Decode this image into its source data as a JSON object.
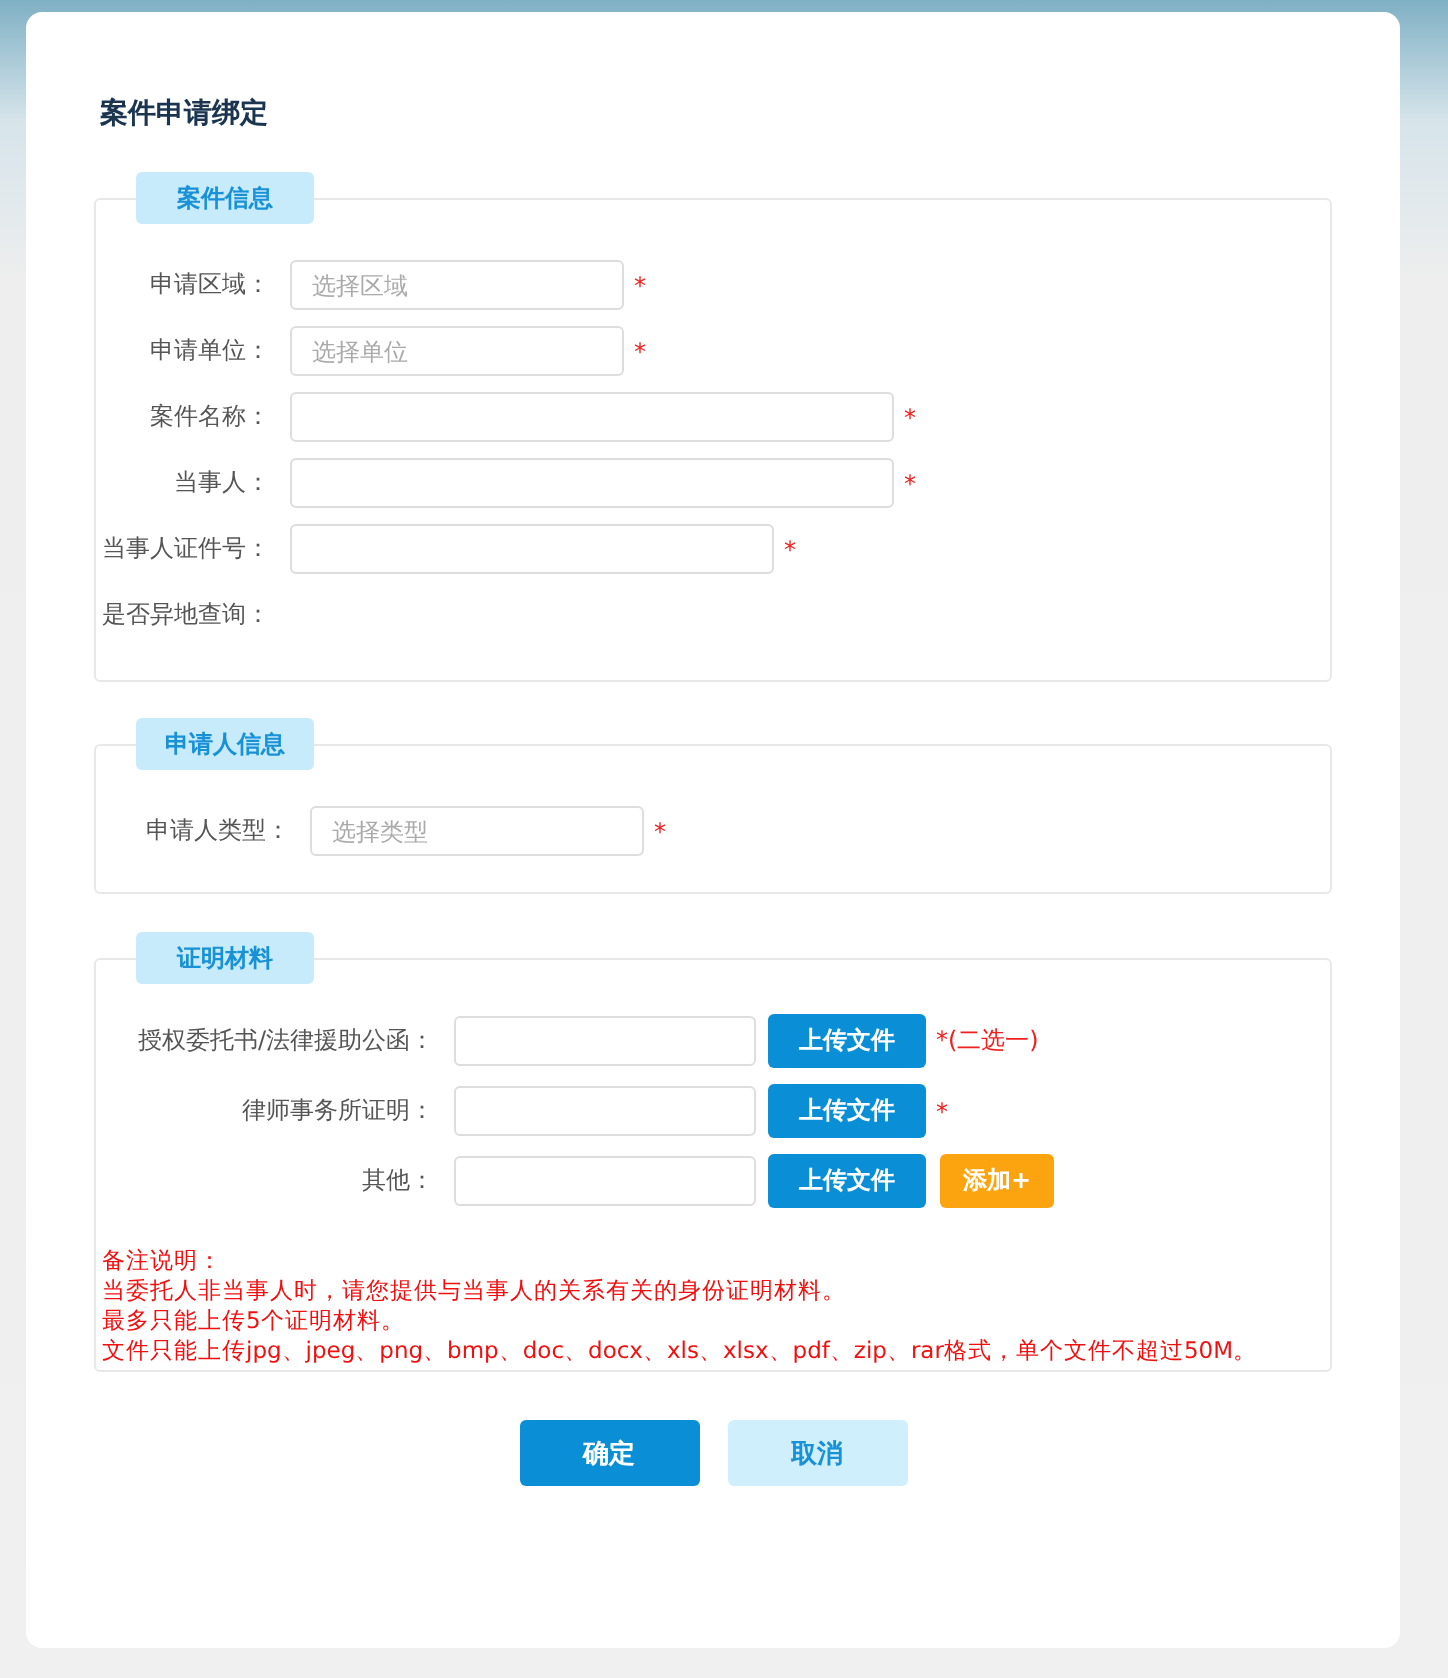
{
  "title": "案件申请绑定",
  "sections": [
    {
      "legend": "案件信息",
      "kind": "basic",
      "rows": [
        {
          "label": "申请区域：",
          "field": {
            "kind": "select",
            "placeholder": "选择区域"
          },
          "mark": "*"
        },
        {
          "label": "申请单位：",
          "field": {
            "kind": "select",
            "placeholder": "选择单位"
          },
          "mark": "*"
        },
        {
          "label": "案件名称：",
          "field": {
            "kind": "wide"
          },
          "mark": "*"
        },
        {
          "label": "当事人：",
          "field": {
            "kind": "wide"
          },
          "mark": "*"
        },
        {
          "label": "当事人证件号：",
          "field": {
            "kind": "medium"
          },
          "mark": "*"
        },
        {
          "label": "是否异地查询："
        }
      ]
    },
    {
      "legend": "申请人信息",
      "kind": "applicant",
      "rows": [
        {
          "label": "申请人类型：",
          "field": {
            "kind": "select",
            "placeholder": "选择类型"
          },
          "mark": "*"
        }
      ]
    },
    {
      "legend": "证明材料",
      "kind": "upload",
      "rows": [
        {
          "label": "授权委托书/法律援助公函：",
          "field": {
            "kind": "file"
          },
          "upload": "上传文件",
          "mark": "*(二选一)"
        },
        {
          "label": "律师事务所证明：",
          "field": {
            "kind": "file"
          },
          "upload": "上传文件",
          "mark": "*"
        },
        {
          "label": "其他：",
          "field": {
            "kind": "file"
          },
          "upload": "上传文件",
          "add": "添加+"
        }
      ],
      "notes": [
        "备注说明：",
        "当委托人非当事人时，请您提供与当事人的关系有关的身份证明材料。",
        "最多只能上传5个证明材料。",
        "文件只能上传jpg、jpeg、png、bmp、doc、docx、xls、xlsx、pdf、zip、rar格式，单个文件不超过50M。"
      ]
    }
  ],
  "buttons": [
    {
      "label": "确定",
      "kind": "primary"
    },
    {
      "label": "取消",
      "kind": "secondary"
    }
  ]
}
